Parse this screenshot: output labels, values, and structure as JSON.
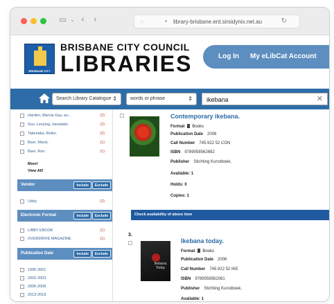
{
  "browser": {
    "url": "library-brisbane.ent.sirsidynix.net.au"
  },
  "header": {
    "council": "BRISBANE CITY COUNCIL",
    "libraries": "LIBRARIES",
    "logo_caption": "BRISBANE CITY",
    "login": "Log In",
    "my_account": "My eLibCat Account"
  },
  "search": {
    "scope": "Search Library Catalogue",
    "mode": "words or phrase",
    "query": "ikebana"
  },
  "sidebar": {
    "authors": [
      {
        "label": "Harden, Marcia Gay, au...",
        "count": "(2)"
      },
      {
        "label": "Soo, Leeying, translator.",
        "count": "(2)"
      },
      {
        "label": "Takenaka, Reiko.",
        "count": "(2)"
      },
      {
        "label": "Baer, Mavis.",
        "count": "(1)"
      },
      {
        "label": "Baer, Ron.",
        "count": "(1)"
      }
    ],
    "more": "More!",
    "view_all": "View All!",
    "vendor": {
      "title": "Vendor",
      "include": "Include",
      "exclude": "Exclude",
      "items": [
        {
          "label": "Libby",
          "count": "(2)"
        }
      ]
    },
    "electronic_format": {
      "title": "Electronic Format",
      "include": "Include",
      "exclude": "Exclude",
      "items": [
        {
          "label": "LIBBY EBOOK",
          "count": "(1)"
        },
        {
          "label": "OVERDRIVE MAGAZINE",
          "count": "(1)"
        }
      ]
    },
    "publication_date": {
      "title": "Publication Date",
      "include": "Include",
      "exclude": "Exclude",
      "items": [
        {
          "label": "1995-2001"
        },
        {
          "label": "2002-2003"
        },
        {
          "label": "2006-2008"
        },
        {
          "label": "2013-2018"
        },
        {
          "label": "2019-2023"
        }
      ]
    }
  },
  "results": [
    {
      "title": "Contemporary ikebana.",
      "cover_text": "IKEBANA",
      "format_label": "Format",
      "format": "Books",
      "pubdate_label": "Publication Date",
      "pubdate": "2006",
      "call_label": "Call Number",
      "call": "745.922 52 CON",
      "isbn_label": "ISBN",
      "isbn": "9789058562692",
      "publisher_label": "Publisher",
      "publisher": "Stichting Kunstboek,",
      "available": "Available: 1",
      "holds": "Holds: 0",
      "copies": "Copies: 1",
      "availability_bar": "Check availability of above item"
    },
    {
      "number": "3.",
      "title": "Ikebana today.",
      "cover_text": "Ikebana Today",
      "format_label": "Format",
      "format": "Books",
      "pubdate_label": "Publication Date",
      "pubdate": "2006",
      "call_label": "Call Number",
      "call": "745.922 52 IKE",
      "isbn_label": "ISBN",
      "isbn": "9789058562081",
      "publisher_label": "Publisher",
      "publisher": "Stichting Kunstboek,",
      "available": "Available: 1"
    }
  ]
}
